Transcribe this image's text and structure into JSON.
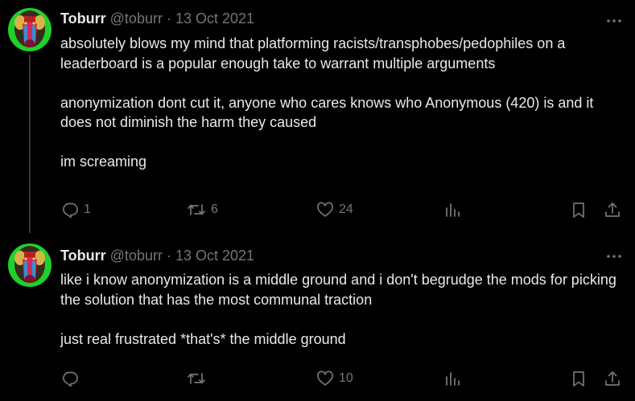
{
  "tweets": [
    {
      "author": {
        "display_name": "Toburr",
        "handle": "@toburr"
      },
      "separator": "·",
      "date": "13 Oct 2021",
      "paragraphs": [
        "absolutely blows my mind that platforming racists/transphobes/pedophiles on a leaderboard is a popular enough take to warrant multiple arguments",
        "anonymization dont cut it, anyone who cares knows who Anonymous (420) is and it does not diminish the harm they caused",
        "im screaming"
      ],
      "stats": {
        "replies": "1",
        "retweets": "6",
        "likes": "24"
      }
    },
    {
      "author": {
        "display_name": "Toburr",
        "handle": "@toburr"
      },
      "separator": "·",
      "date": "13 Oct 2021",
      "paragraphs": [
        "like i know anonymization is a middle ground and i don't begrudge the mods for picking the solution that has the most communal traction",
        "just real frustrated *that's* the middle ground"
      ],
      "stats": {
        "replies": "",
        "retweets": "",
        "likes": "10"
      }
    }
  ],
  "icons": {
    "more": "more-dots-icon",
    "reply": "reply-icon",
    "retweet": "retweet-icon",
    "like": "heart-icon",
    "views": "views-icon",
    "bookmark": "bookmark-icon",
    "share": "share-icon"
  },
  "colors": {
    "background": "#000000",
    "text_primary": "#e7e9ea",
    "text_secondary": "#71767b",
    "thread_line": "#333639",
    "avatar_bg": "#1fd12b"
  }
}
